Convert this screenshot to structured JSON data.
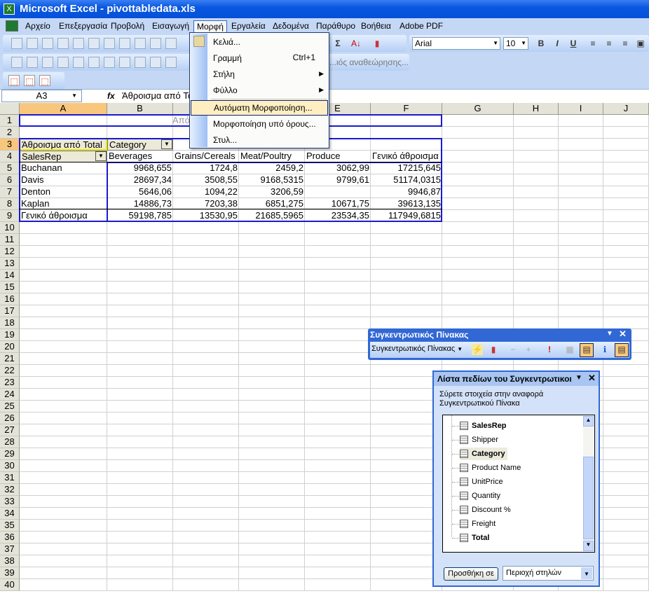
{
  "window": {
    "title": "Microsoft Excel - pivottabledata.xls"
  },
  "menubar": [
    "Αρχείο",
    "Επεξεργασία",
    "Προβολή",
    "Εισαγωγή",
    "Μορφή",
    "Εργαλεία",
    "Δεδομένα",
    "Παράθυρο",
    "Βοήθεια",
    "Adobe PDF"
  ],
  "toolbar": {
    "font": "Arial",
    "size": "10",
    "bold": "B",
    "italic": "I",
    "underline": "U",
    "review_text": "...ιός αναθεώρησης..."
  },
  "formula": {
    "namebox": "A3",
    "fx": "fx",
    "value": "Άθροισμα από Total"
  },
  "format_menu": {
    "items": [
      {
        "label": "Κελιά...",
        "shortcut": "Ctrl+1"
      },
      {
        "label": "Γραμμή",
        "submenu": true
      },
      {
        "label": "Στήλη",
        "submenu": true
      },
      {
        "label": "Φύλλο",
        "submenu": true
      },
      {
        "label": "Αυτόματη Μορφοποίηση...",
        "highlighted": true
      },
      {
        "label": "Μορφοποίηση υπό όρους..."
      },
      {
        "label": "Στυλ..."
      }
    ]
  },
  "grid": {
    "columns": [
      "A",
      "B",
      "C",
      "D",
      "E",
      "F",
      "G",
      "H",
      "I",
      "J"
    ],
    "rows": [
      "1",
      "2",
      "3",
      "4",
      "5",
      "6",
      "7",
      "8",
      "9",
      "10",
      "11",
      "12",
      "13",
      "14",
      "15",
      "16",
      "17",
      "18",
      "19",
      "20",
      "21",
      "22",
      "23",
      "24",
      "25",
      "26",
      "27",
      "28",
      "29",
      "30",
      "31",
      "32",
      "33",
      "34",
      "35",
      "36",
      "37",
      "38",
      "39",
      "40"
    ],
    "selected_cell": "A3"
  },
  "pivot": {
    "row1_text": "Απόθ",
    "data_field": "Άθροισμα από Total",
    "column_field": "Category",
    "row_field": "SalesRep",
    "headers": [
      "Beverages",
      "Grains/Cereals",
      "Meat/Poultry",
      "Produce",
      "Γενικό άθροισμα"
    ],
    "rows": [
      [
        "Buchanan",
        "9968,655",
        "1724,8",
        "2459,2",
        "3062,99",
        "17215,645"
      ],
      [
        "Davis",
        "28697,34",
        "3508,55",
        "9168,5315",
        "9799,61",
        "51174,0315"
      ],
      [
        "Denton",
        "5646,06",
        "1094,22",
        "3206,59",
        "",
        "9946,87"
      ],
      [
        "Kaplan",
        "14886,73",
        "7203,38",
        "6851,275",
        "10671,75",
        "39613,135"
      ],
      [
        "Γενικό άθροισμα",
        "59198,785",
        "13530,95",
        "21685,5965",
        "23534,35",
        "117949,6815"
      ]
    ]
  },
  "pivot_toolbar": {
    "title": "Συγκεντρωτικός Πίνακας",
    "menu": "Συγκεντρωτικός Πίνακας"
  },
  "field_list": {
    "title": "Λίστα πεδίων του Συγκεντρωτικοι",
    "hint1": "Σύρετε στοιχεία στην αναφορά",
    "hint2": "Συγκεντρωτικού Πίνακα",
    "fields": [
      {
        "name": "SalesRep",
        "bold": true
      },
      {
        "name": "Shipper"
      },
      {
        "name": "Category",
        "bold": true,
        "highlight": true
      },
      {
        "name": "Product Name"
      },
      {
        "name": "UnitPrice"
      },
      {
        "name": "Quantity"
      },
      {
        "name": "Discount %"
      },
      {
        "name": "Freight"
      },
      {
        "name": "Total",
        "bold": true
      }
    ],
    "add_button": "Προσθήκη σε",
    "area": "Περιοχή στηλών"
  }
}
